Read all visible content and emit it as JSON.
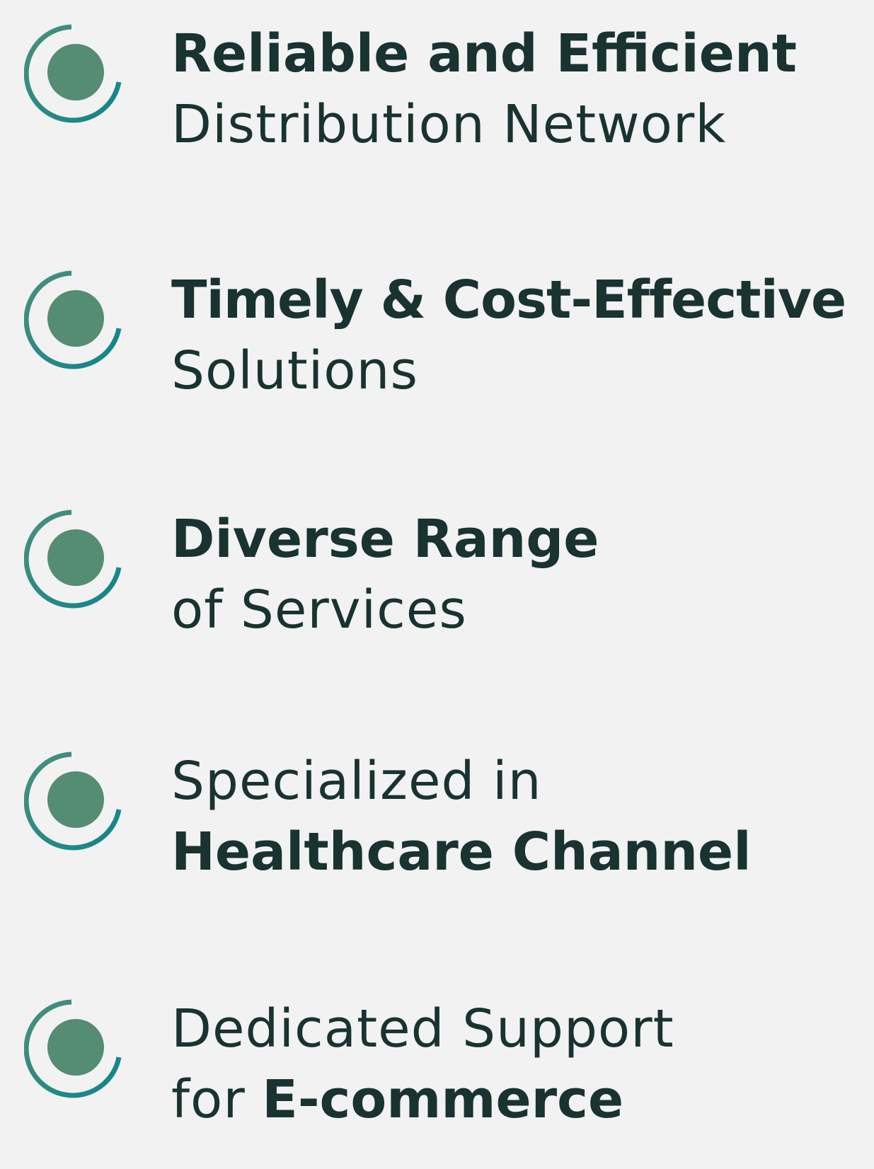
{
  "colors": {
    "background": "#f2f2f2",
    "text": "#183330",
    "icon_dot": "#548c74",
    "icon_ring_start": "#4a8f7d",
    "icon_ring_end": "#0f858a"
  },
  "icon_name": "target-ring-icon",
  "features": [
    {
      "line1_bold": "Reliable and Efficient",
      "line2_light": "Distribution Network"
    },
    {
      "line1_bold": "Timely & Cost-Effective",
      "line2_light": "Solutions"
    },
    {
      "line1_bold": "Diverse Range",
      "line2_light": "of Services"
    },
    {
      "line1_light": "Specialized in",
      "line2_bold": "Healthcare Channel"
    },
    {
      "line1_light": "Dedicated Support",
      "line2_light": "for",
      "line2_bold": "E-commerce"
    }
  ]
}
